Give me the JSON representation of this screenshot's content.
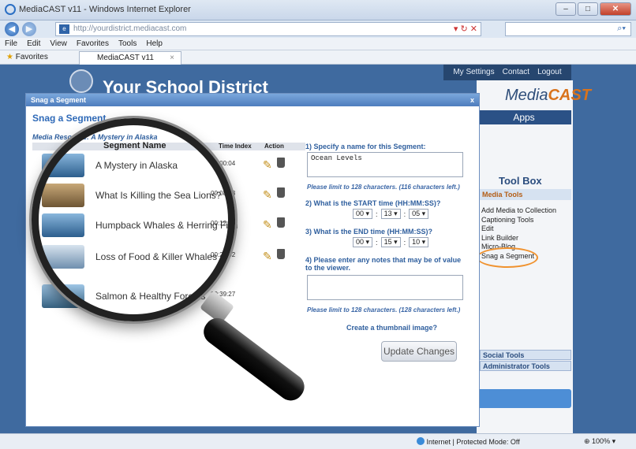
{
  "browser": {
    "window_title": "MediaCAST v11 - Windows Internet Explorer",
    "url": "http://yourdistrict.mediacast.com",
    "menu": [
      "File",
      "Edit",
      "View",
      "Favorites",
      "Tools",
      "Help"
    ],
    "favorites_label": "Favorites",
    "tab_title": "MediaCAST v11",
    "status_text": "Internet | Protected Mode: Off",
    "zoom": "100%"
  },
  "site": {
    "district_name": "Your School District",
    "top_nav": [
      "My Settings",
      "Contact",
      "Logout"
    ],
    "logo_part1": "Media",
    "logo_part2": "CAST",
    "apps_label": "Apps",
    "toolbox_title": "Tool Box",
    "media_tools_header": "Media Tools",
    "media_tools": [
      "Add Media to Collection",
      "Captioning Tools",
      "Edit",
      "Link Builder",
      "Micro-Blog",
      "Snag a Segment"
    ],
    "social_tools_header": "Social Tools",
    "admin_tools_header": "Administrator Tools"
  },
  "dialog": {
    "title": "Snag a Segment",
    "close_label": "x",
    "heading": "Snag a Segment",
    "media_resource": "Media Resource: A Mystery in Alaska",
    "columns": {
      "segment": "Segment Name",
      "time": "Time Index",
      "action": "Action"
    },
    "segments": [
      {
        "name": "A Mystery in Alaska",
        "time": "00:00:04"
      },
      {
        "name": "What Is Killing the Sea Lions?",
        "time": "00:08:13"
      },
      {
        "name": "Humpback Whales & Herring Fish",
        "time": "00:12:50"
      },
      {
        "name": "Loss of Food & Killer Whales",
        "time": "00:29:02"
      },
      {
        "name": "Salmon & Healthy Forests",
        "time": "00:39:27"
      }
    ],
    "form": {
      "q1": "1) Specify a name for this Segment:",
      "q1_value": "Ocean Levels",
      "limit1": "Please limit to 128 characters. (116 characters left.)",
      "q2": "2) What is the START time (HH:MM:SS)?",
      "start": [
        "00",
        "13",
        "05"
      ],
      "q3": "3) What is the END time (HH:MM:SS)?",
      "end": [
        "00",
        "15",
        "10"
      ],
      "q4": "4) Please enter any notes that may be of value to the viewer.",
      "limit2": "Please limit to 128 characters. (128 characters left.)",
      "q5": "Create a thumbnail image?",
      "update_label": "Update Changes"
    }
  }
}
